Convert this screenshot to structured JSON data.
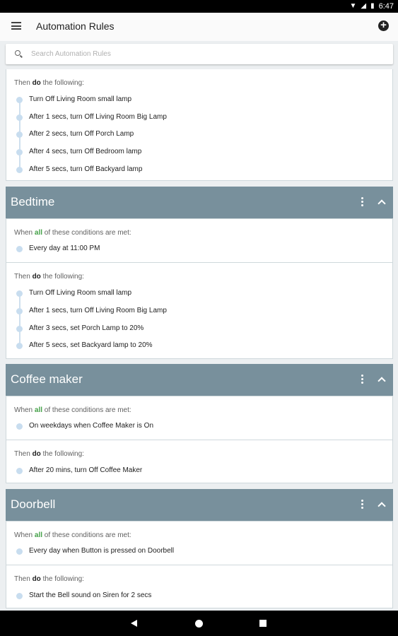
{
  "status_bar": {
    "time": "6:47"
  },
  "app_bar": {
    "title": "Automation Rules"
  },
  "search": {
    "placeholder": "Search Automation Rules"
  },
  "labels": {
    "then_prefix": "Then ",
    "then_keyword": "do",
    "then_suffix": " the following:",
    "when_prefix": "When ",
    "when_keyword": "all",
    "when_suffix": " of these conditions are met:"
  },
  "partial_rule": {
    "actions": [
      "Turn Off Living Room small lamp",
      "After 1 secs, turn Off Living Room Big Lamp",
      "After 2 secs, turn Off Porch Lamp",
      "After 4 secs, turn Off Bedroom lamp",
      "After 5 secs, turn Off Backyard lamp"
    ]
  },
  "rules": [
    {
      "name": "Bedtime",
      "conditions": [
        "Every day at 11:00 PM"
      ],
      "actions": [
        "Turn Off Living Room small lamp",
        "After 1 secs, turn Off Living Room Big Lamp",
        "After 3 secs, set Porch Lamp to 20%",
        "After 5 secs, set Backyard lamp to 20%"
      ]
    },
    {
      "name": "Coffee maker",
      "conditions": [
        "On weekdays when Coffee Maker is On"
      ],
      "actions": [
        "After 20 mins, turn Off Coffee Maker"
      ]
    },
    {
      "name": "Doorbell",
      "conditions": [
        "Every day when Button is pressed on Doorbell"
      ],
      "actions": [
        "Start the Bell sound on Siren for 2 secs"
      ]
    }
  ],
  "colors": {
    "header": "#78909c",
    "accent_all": "#43a047",
    "timeline_dot": "#c8ddef"
  }
}
